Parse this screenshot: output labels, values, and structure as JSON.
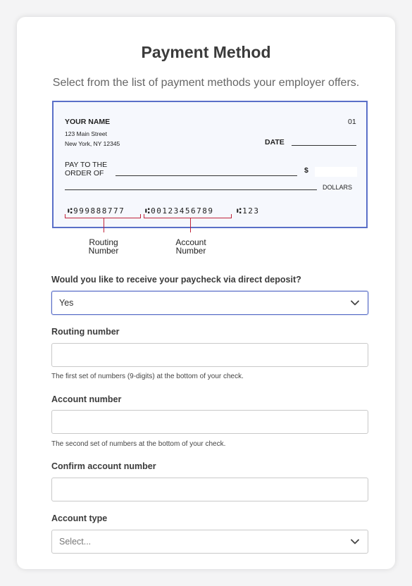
{
  "header": {
    "title": "Payment Method",
    "subtitle": "Select from the list of payment methods your employer offers."
  },
  "check": {
    "name": "YOUR NAME",
    "address1": "123 Main Street",
    "address2": "New York, NY 12345",
    "number": "01",
    "date_label": "DATE",
    "pay_to_line1": "PAY TO THE",
    "pay_to_line2": "ORDER OF",
    "dollar_sign": "$",
    "dollars_label": "DOLLARS",
    "micr_routing": "⑆999888777",
    "micr_account": "⑆00123456789",
    "micr_check": "⑆123",
    "routing_label_1": "Routing",
    "routing_label_2": "Number",
    "account_label_1": "Account",
    "account_label_2": "Number"
  },
  "form": {
    "direct_deposit": {
      "label": "Would you like to receive your paycheck via direct deposit?",
      "value": "Yes"
    },
    "routing": {
      "label": "Routing number",
      "value": "",
      "hint": "The first set of numbers (9-digits) at the bottom of your check."
    },
    "account": {
      "label": "Account number",
      "value": "",
      "hint": "The second set of numbers at the bottom of your check."
    },
    "confirm_account": {
      "label": "Confirm account number",
      "value": ""
    },
    "account_type": {
      "label": "Account type",
      "placeholder": "Select..."
    }
  },
  "colors": {
    "check_border": "#5a6fc8",
    "check_bg": "#f6f8fd",
    "bracket": "#c0233a"
  },
  "icons": {
    "select_chevron": "chevron-down-icon"
  }
}
